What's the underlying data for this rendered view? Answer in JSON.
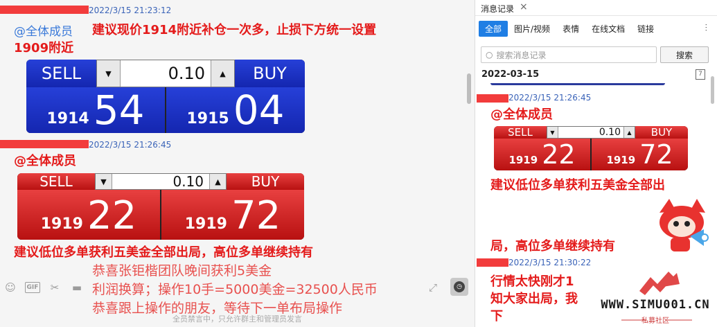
{
  "chat": {
    "messages": [
      {
        "timestamp": "2022/3/15 21:23:12",
        "mention": "@全体成员",
        "text_line1": "建议现价1914附近补仓一次多，止损下方统一设置",
        "text_line2": "1909附近"
      },
      {
        "timestamp": "2022/3/15 21:26:45",
        "mention": "@全体成员",
        "text": "建议低位多单获利五美金全部出局，高位多单继续持有"
      }
    ],
    "widget_blue": {
      "sell_label": "SELL",
      "buy_label": "BUY",
      "qty": "0.10",
      "sell_small": "1914",
      "sell_big": "54",
      "buy_small": "1915",
      "buy_big": "04"
    },
    "widget_red": {
      "sell_label": "SELL",
      "buy_label": "BUY",
      "qty": "0.10",
      "sell_small": "1919",
      "sell_big": "22",
      "buy_small": "1919",
      "buy_big": "72"
    },
    "overlay_lines": [
      "恭喜张钜楷团队晚间获利5美金",
      "利润换算；操作10手=5000美金=32500人民币",
      "恭喜跟上操作的朋友，等待下一单布局操作"
    ],
    "mute_notice": "全员禁言中，只允许群主和管理员发言",
    "toolbar": {
      "gif_label": "GIF"
    }
  },
  "history": {
    "title": "消息记录",
    "tabs": [
      "全部",
      "图片/视频",
      "表情",
      "在线文档",
      "链接"
    ],
    "search_placeholder": "搜索消息记录",
    "search_button": "搜索",
    "date": "2022-03-15",
    "messages": [
      {
        "timestamp": "2022/3/15 21:26:45",
        "mention": "@全体成员",
        "text_line1": "建议低位多单获利五美金全部出",
        "text_line2": "局，高位多单继续持有"
      },
      {
        "timestamp": "2022/3/15 21:30:22",
        "text_line1": "行情太快刚才1",
        "text_line2": "知大家出局，我",
        "text_line3": "下"
      }
    ],
    "widget": {
      "sell_label": "SELL",
      "buy_label": "BUY",
      "qty": "0.10",
      "sell_small": "1919",
      "sell_big": "22",
      "buy_small": "1919",
      "buy_big": "72"
    }
  },
  "watermark": {
    "site": "WWW.SIMU001.CN",
    "sub": "私募社区"
  }
}
